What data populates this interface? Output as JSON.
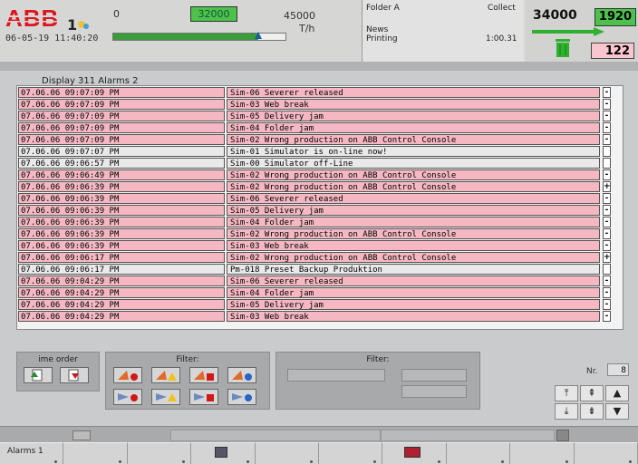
{
  "header": {
    "line_number": "1",
    "datetime": "06-05-19 11:40:20",
    "scale_min": "0",
    "speed_value": "32000",
    "scale_max": "45000",
    "unit": "T/h",
    "speed_fraction": 0.84,
    "folder": {
      "name": "Folder A",
      "mode": "Collect",
      "line2": "News",
      "line3": "Printing",
      "time": "1:00.31"
    },
    "count_left": "34000",
    "count_right": "1920",
    "waste_count": "122"
  },
  "display_title": "Display 311 Alarms 2",
  "alarms": [
    {
      "time": "07.06.06 09:07:09 PM",
      "message": "Sim-06 Severer released",
      "ack": "-",
      "state": "pink"
    },
    {
      "time": "07.06.06 09:07:09 PM",
      "message": "Sim-03 Web break",
      "ack": "-",
      "state": "pink"
    },
    {
      "time": "07.06.06 09:07:09 PM",
      "message": "Sim-05 Delivery jam",
      "ack": "-",
      "state": "pink"
    },
    {
      "time": "07.06.06 09:07:09 PM",
      "message": "Sim-04 Folder jam",
      "ack": "-",
      "state": "pink"
    },
    {
      "time": "07.06.06 09:07:09 PM",
      "message": "Sim-02 Wrong production on ABB Control Console",
      "ack": "-",
      "state": "pink"
    },
    {
      "time": "07.06.06 09:07:07 PM",
      "message": "Sim-01  Simulator is on-line now!",
      "ack": "",
      "state": "gray"
    },
    {
      "time": "07.06.06 09:06:57 PM",
      "message": "Sim-00 Simulator off-Line",
      "ack": "",
      "state": "gray"
    },
    {
      "time": "07.06.06 09:06:49 PM",
      "message": "Sim-02 Wrong production on ABB Control Console",
      "ack": "-",
      "state": "pink"
    },
    {
      "time": "07.06.06 09:06:39 PM",
      "message": "Sim-02 Wrong production on ABB Control Console",
      "ack": "+",
      "state": "pink"
    },
    {
      "time": "07.06.06 09:06:39 PM",
      "message": "Sim-06 Severer released",
      "ack": "-",
      "state": "pink"
    },
    {
      "time": "07.06.06 09:06:39 PM",
      "message": "Sim-05 Delivery jam",
      "ack": "-",
      "state": "pink"
    },
    {
      "time": "07.06.06 09:06:39 PM",
      "message": "Sim-04 Folder jam",
      "ack": "-",
      "state": "pink"
    },
    {
      "time": "07.06.06 09:06:39 PM",
      "message": "Sim-02 Wrong production on ABB Control Console",
      "ack": "-",
      "state": "pink"
    },
    {
      "time": "07.06.06 09:06:39 PM",
      "message": "Sim-03 Web break",
      "ack": "-",
      "state": "pink"
    },
    {
      "time": "07.06.06 09:06:17 PM",
      "message": "Sim-02 Wrong production on ABB Control Console",
      "ack": "+",
      "state": "pink"
    },
    {
      "time": "07.06.06 09:06:17 PM",
      "message": "Pm-018 Preset Backup Produktion",
      "ack": "",
      "state": "gray"
    },
    {
      "time": "07.06.06 09:04:29 PM",
      "message": "Sim-06 Severer released",
      "ack": "-",
      "state": "pink"
    },
    {
      "time": "07.06.06 09:04:29 PM",
      "message": "Sim-04 Folder jam",
      "ack": "-",
      "state": "pink"
    },
    {
      "time": "07.06.06 09:04:29 PM",
      "message": "Sim-05 Delivery jam",
      "ack": "-",
      "state": "pink"
    },
    {
      "time": "07.06.06 09:04:29 PM",
      "message": "Sim-03 Web break",
      "ack": "-",
      "state": "pink"
    }
  ],
  "time_order_label": "ime order",
  "filter1_label": "Filter:",
  "filter2_label": "Filter:",
  "nr_label": "Nr.",
  "nr_value": "8",
  "softkeys": [
    "Alarms 1",
    "",
    "",
    "",
    "",
    "",
    "",
    "",
    "",
    ""
  ],
  "colors": {
    "pink": "#f5b8c2",
    "gray": "#e9e9e9",
    "green": "#4cc24c"
  }
}
